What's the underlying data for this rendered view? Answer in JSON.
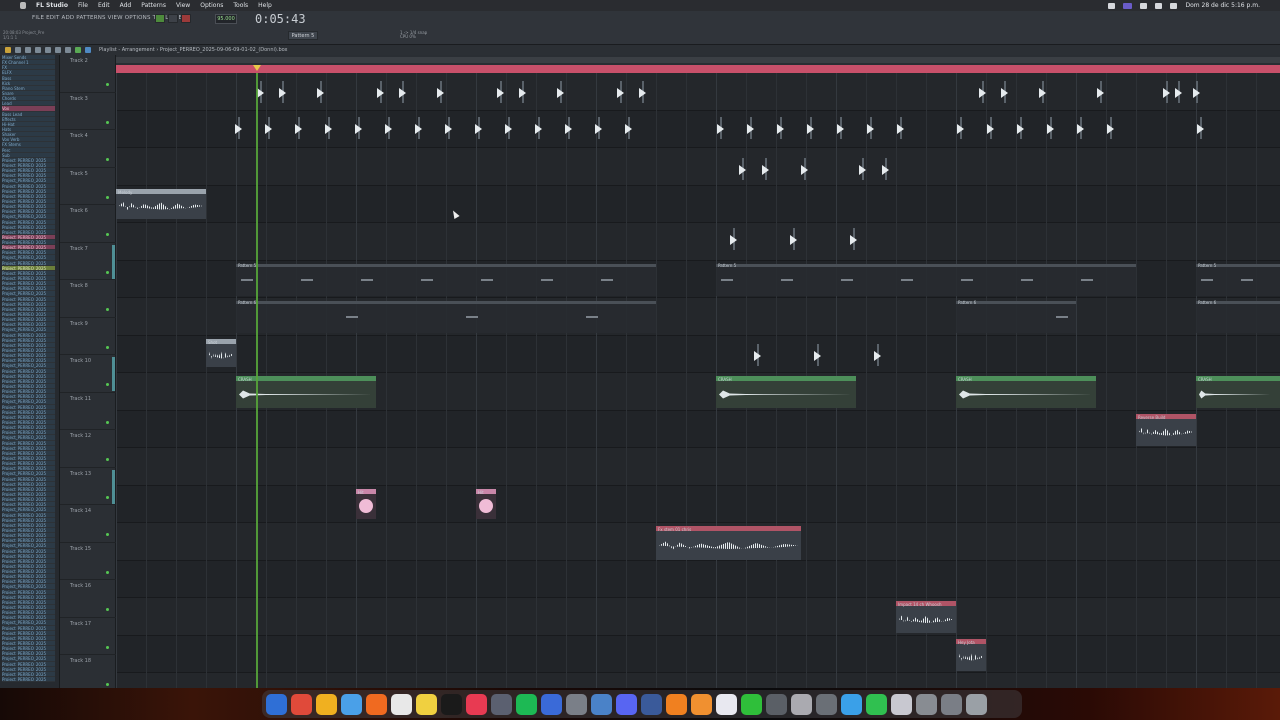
{
  "macos_menubar": {
    "app_name": "FL Studio",
    "menus": [
      "File",
      "Edit",
      "Add",
      "Patterns",
      "View",
      "Options",
      "Tools",
      "Help"
    ],
    "clock": "Dom 28 de dic 5:16 p.m."
  },
  "fl_menu": {
    "menu_text": "FILE EDIT ADD PATTERNS VIEW OPTIONS TOOLS HELP",
    "hint_line1": "20:08:03 Project_Pre",
    "hint_line2": "1/1:1 1",
    "tempo": "95.000",
    "time_display": "0:05:43",
    "pattern": "Pattern 5",
    "snap_hint_line1": "1 -> 1/4 snap",
    "snap_hint_line2": "CPU 0%"
  },
  "toolbar": {
    "breadcrumb": "Playlist - Arrangement › Project_PERREO_2025-09-06-09-01-02_(Donni).box"
  },
  "browser": {
    "items": [
      {
        "label": "Mixer Sends",
        "style": "normal"
      },
      {
        "label": "FX Channel 1",
        "style": "normal"
      },
      {
        "label": "FX",
        "style": "normal"
      },
      {
        "label": "ELFX",
        "style": "normal"
      },
      {
        "label": "Bass",
        "style": "normal"
      },
      {
        "label": "Kick",
        "style": "normal"
      },
      {
        "label": "Piano Stem",
        "style": "normal"
      },
      {
        "label": "Snare",
        "style": "normal"
      },
      {
        "label": "Chords",
        "style": "normal"
      },
      {
        "label": "Lead",
        "style": "normal"
      },
      {
        "label": "Vox",
        "style": "pk"
      },
      {
        "label": "Bass Lead",
        "style": "normal"
      },
      {
        "label": "Effects",
        "style": "normal"
      },
      {
        "label": "Hi-Hat",
        "style": "normal"
      },
      {
        "label": "Hats",
        "style": "normal"
      },
      {
        "label": "Shaker",
        "style": "normal"
      },
      {
        "label": "Vox Verb",
        "style": "normal"
      },
      {
        "label": "FX Stems",
        "style": "normal"
      },
      {
        "label": "Perc",
        "style": "normal"
      },
      {
        "label": "Sub",
        "style": "normal"
      },
      {
        "label": "Project_PERREO_2025",
        "style": "normal"
      },
      {
        "label": "Project_PERREO_2025",
        "style": "normal"
      },
      {
        "label": "Project_PERREO_2025",
        "style": "normal"
      },
      {
        "label": "Project_PERREO_2025",
        "style": "normal"
      },
      {
        "label": "Project_PERREO_2025",
        "style": "normal"
      },
      {
        "label": "Project_PERREO_2025",
        "style": "normal"
      },
      {
        "label": "Project_PERREO_2025",
        "style": "normal"
      },
      {
        "label": "Project_PERREO_2025",
        "style": "normal"
      },
      {
        "label": "Project_PERREO_2025",
        "style": "normal"
      },
      {
        "label": "Project_PERREO_2025",
        "style": "normal"
      },
      {
        "label": "Project_PERREO_2025",
        "style": "normal"
      },
      {
        "label": "Project_PERREO_2025",
        "style": "normal"
      },
      {
        "label": "Project_PERREO_2025",
        "style": "normal"
      },
      {
        "label": "Project_PERREO_2025",
        "style": "normal"
      },
      {
        "label": "Project_PERREO_2025",
        "style": "normal"
      },
      {
        "label": "Project_PERREO_2025",
        "style": "pk"
      },
      {
        "label": "Project_PERREO_2025",
        "style": "normal"
      },
      {
        "label": "Project_PERREO_2025",
        "style": "pk"
      },
      {
        "label": "Project_PERREO_2025",
        "style": "normal"
      },
      {
        "label": "Project_PERREO_2025",
        "style": "normal"
      },
      {
        "label": "Project_PERREO_2025",
        "style": "normal"
      },
      {
        "label": "Project_PERREO_2025",
        "style": "hl"
      },
      {
        "label": "Project_PERREO_2025",
        "style": "normal"
      },
      {
        "label": "Project_PERREO_2025",
        "style": "normal"
      },
      {
        "label": "Project_PERREO_2025",
        "style": "normal"
      },
      {
        "label": "Project_PERREO_2025",
        "style": "normal"
      },
      {
        "label": "Project_PERREO_2025",
        "style": "normal"
      },
      {
        "label": "Project_PERREO_2025",
        "style": "normal"
      },
      {
        "label": "Project_PERREO_2025",
        "style": "normal"
      },
      {
        "label": "Project_PERREO_2025",
        "style": "normal"
      },
      {
        "label": "Project_PERREO_2025",
        "style": "normal"
      },
      {
        "label": "Project_PERREO_2025",
        "style": "normal"
      },
      {
        "label": "Project_PERREO_2025",
        "style": "normal"
      },
      {
        "label": "Project_PERREO_2025",
        "style": "normal"
      },
      {
        "label": "Project_PERREO_2025",
        "style": "normal"
      },
      {
        "label": "Project_PERREO_2025",
        "style": "normal"
      },
      {
        "label": "Project_PERREO_2025",
        "style": "normal"
      },
      {
        "label": "Project_PERREO_2025",
        "style": "normal"
      },
      {
        "label": "Project_PERREO_2025",
        "style": "normal"
      },
      {
        "label": "Project_PERREO_2025",
        "style": "normal"
      },
      {
        "label": "Project_PERREO_2025",
        "style": "normal"
      },
      {
        "label": "Project_PERREO_2025",
        "style": "normal"
      },
      {
        "label": "Project_PERREO_2025",
        "style": "normal"
      },
      {
        "label": "Project_PERREO_2025",
        "style": "normal"
      },
      {
        "label": "Project_PERREO_2025",
        "style": "normal"
      },
      {
        "label": "Project_PERREO_2025",
        "style": "normal"
      },
      {
        "label": "Project_PERREO_2025",
        "style": "normal"
      },
      {
        "label": "Project_PERREO_2025",
        "style": "normal"
      },
      {
        "label": "Project_PERREO_2025",
        "style": "normal"
      },
      {
        "label": "Project_PERREO_2025",
        "style": "normal"
      },
      {
        "label": "Project_PERREO_2025",
        "style": "normal"
      },
      {
        "label": "Project_PERREO_2025",
        "style": "normal"
      },
      {
        "label": "Project_PERREO_2025",
        "style": "normal"
      },
      {
        "label": "Project_PERREO_2025",
        "style": "normal"
      },
      {
        "label": "Project_PERREO_2025",
        "style": "normal"
      },
      {
        "label": "Project_PERREO_2025",
        "style": "normal"
      },
      {
        "label": "Project_PERREO_2025",
        "style": "normal"
      },
      {
        "label": "Project_PERREO_2025",
        "style": "normal"
      },
      {
        "label": "Project_PERREO_2025",
        "style": "normal"
      },
      {
        "label": "Project_PERREO_2025",
        "style": "normal"
      },
      {
        "label": "Project_PERREO_2025",
        "style": "normal"
      },
      {
        "label": "Project_PERREO_2025",
        "style": "normal"
      },
      {
        "label": "Project_PERREO_2025",
        "style": "normal"
      },
      {
        "label": "Project_PERREO_2025",
        "style": "normal"
      },
      {
        "label": "Project_PERREO_2025",
        "style": "normal"
      },
      {
        "label": "Project_PERREO_2025",
        "style": "normal"
      },
      {
        "label": "Project_PERREO_2025",
        "style": "normal"
      },
      {
        "label": "Project_PERREO_2025",
        "style": "normal"
      },
      {
        "label": "Project_PERREO_2025",
        "style": "normal"
      },
      {
        "label": "Project_PERREO_2025",
        "style": "normal"
      },
      {
        "label": "Project_PERREO_2025",
        "style": "normal"
      },
      {
        "label": "Project_PERREO_2025",
        "style": "normal"
      },
      {
        "label": "Project_PERREO_2025",
        "style": "normal"
      },
      {
        "label": "Project_PERREO_2025",
        "style": "normal"
      },
      {
        "label": "Project_PERREO_2025",
        "style": "normal"
      },
      {
        "label": "Project_PERREO_2025",
        "style": "normal"
      },
      {
        "label": "Project_PERREO_2025",
        "style": "normal"
      },
      {
        "label": "Project_PERREO_2025",
        "style": "normal"
      },
      {
        "label": "Project_PERREO_2025",
        "style": "normal"
      },
      {
        "label": "Project_PERREO_2025",
        "style": "normal"
      },
      {
        "label": "Project_PERREO_2025",
        "style": "normal"
      },
      {
        "label": "Project_PERREO_2025",
        "style": "normal"
      },
      {
        "label": "Project_PERREO_2025",
        "style": "normal"
      },
      {
        "label": "Project_PERREO_2025",
        "style": "normal"
      },
      {
        "label": "Project_PERREO_2025",
        "style": "normal"
      },
      {
        "label": "Project_PERREO_2025",
        "style": "normal"
      },
      {
        "label": "Project_PERREO_2025",
        "style": "normal"
      },
      {
        "label": "Project_PERREO_2025",
        "style": "normal"
      },
      {
        "label": "Project_PERREO_2025",
        "style": "normal"
      },
      {
        "label": "Project_PERREO_2025",
        "style": "normal"
      },
      {
        "label": "Project_PERREO_2025",
        "style": "normal"
      },
      {
        "label": "Project_PERREO_2025",
        "style": "normal"
      },
      {
        "label": "Project_PERREO_2025",
        "style": "normal"
      },
      {
        "label": "Project_PERREO_2025",
        "style": "normal"
      },
      {
        "label": "Project_PERREO_2025",
        "style": "normal"
      },
      {
        "label": "Project_PERREO_2025",
        "style": "normal"
      },
      {
        "label": "Project_PERREO_2025",
        "style": "normal"
      },
      {
        "label": "Project_PERREO_2025",
        "style": "normal"
      },
      {
        "label": "Project_PERREO_2025",
        "style": "normal"
      },
      {
        "label": "Project_PERREO_2025",
        "style": "normal"
      },
      {
        "label": "Project_PERREO_2025",
        "style": "normal"
      },
      {
        "label": "Project_PERREO_2025",
        "style": "normal"
      }
    ]
  },
  "tracks": [
    {
      "name": "Track 2",
      "active": false
    },
    {
      "name": "Track 3",
      "active": false
    },
    {
      "name": "Track 4",
      "active": false
    },
    {
      "name": "Track 5",
      "active": false
    },
    {
      "name": "Track 6",
      "active": false
    },
    {
      "name": "Track 7",
      "active": true
    },
    {
      "name": "Track 8",
      "active": false
    },
    {
      "name": "Track 9",
      "active": false
    },
    {
      "name": "Track 10",
      "active": true
    },
    {
      "name": "Track 11",
      "active": false
    },
    {
      "name": "Track 12",
      "active": false
    },
    {
      "name": "Track 13",
      "active": true
    },
    {
      "name": "Track 14",
      "active": false
    },
    {
      "name": "Track 15",
      "active": false
    },
    {
      "name": "Track 16",
      "active": false
    },
    {
      "name": "Track 17",
      "active": false
    },
    {
      "name": "Track 18",
      "active": false
    }
  ],
  "clip_labels": {
    "melody": "Melody",
    "pattern5": "Pattern 5",
    "pattern6": "Pattern 6",
    "crash": "CRASH",
    "impact": "Impact",
    "shot": "Shot",
    "reverse_fx": "Reverse Build",
    "pinkhit": "Hit",
    "vocal": "Fx stem 01 chris",
    "fx16": "Impact 14 ch Whoosh",
    "fx17": "Hey Jota"
  },
  "colors": {
    "timeline": "#c8506a",
    "playhead": "#57a53a",
    "accent_green": "#56c653"
  }
}
